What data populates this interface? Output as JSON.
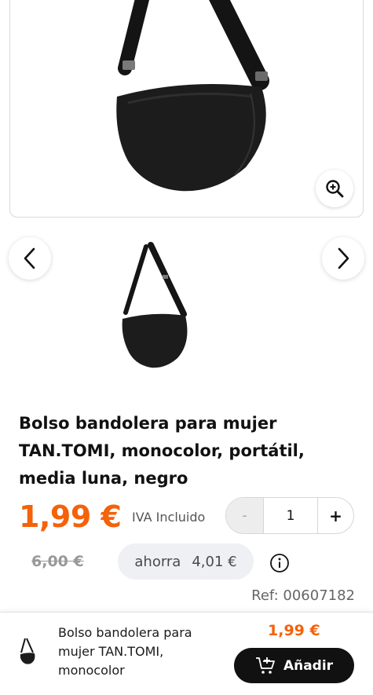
{
  "gallery": {
    "main_image_alt": "Bolso bandolera negro",
    "zoom_icon": "zoom-in-icon",
    "prev_icon": "chevron-left-icon",
    "next_icon": "chevron-right-icon"
  },
  "product": {
    "title": "Bolso bandolera para mujer TAN.TOMI, monocolor, portátil, media luna, negro",
    "price": "1,99 €",
    "tax_note": "IVA Incluido",
    "old_price": "6,00 €",
    "savings_label": "ahorra",
    "savings_value": "4,01 €",
    "reference": "Ref: 00607182",
    "info_icon": "info-icon"
  },
  "quantity": {
    "minus_label": "-",
    "value": "1",
    "plus_label": "+"
  },
  "bottom_bar": {
    "name": "Bolso bandolera para mujer TAN.TOMI, monocolor",
    "price": "1,99 €",
    "add_label": "Añadir",
    "cart_icon": "cart-add-icon"
  },
  "colors": {
    "accent": "#f4620a",
    "button_dark": "#111111",
    "savings_bg": "#eef0f3"
  }
}
